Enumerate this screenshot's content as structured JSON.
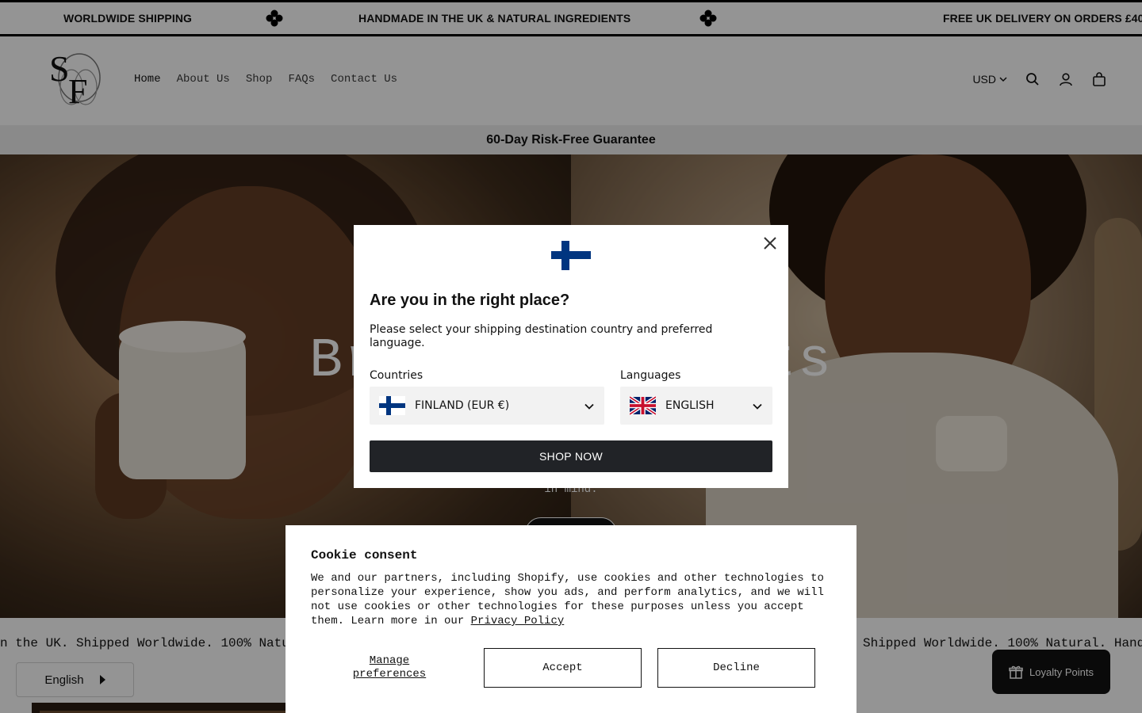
{
  "announcement": {
    "items": [
      "WORLDWIDE SHIPPING",
      "HANDMADE IN THE UK & NATURAL INGREDIENTS",
      "FREE UK DELIVERY ON ORDERS £40"
    ],
    "separator_icon": "four-petal-flower-icon"
  },
  "header": {
    "logo_text": "SF",
    "nav": [
      "Home",
      "About Us",
      "Shop",
      "FAQs",
      "Contact Us"
    ],
    "currency": "USD",
    "icons": [
      "search-icon",
      "account-icon",
      "cart-icon"
    ]
  },
  "guarantee": {
    "text": "60-Day Risk-Free Guarantee"
  },
  "hero": {
    "title": "Browse Products",
    "subtitle": "in mind."
  },
  "band": {
    "segments": [
      "n the UK. Shipped Worldwide.  100% Natu",
      "Shipped Worldwide.  100% Natural. Hand"
    ]
  },
  "language_switch": {
    "label": "English"
  },
  "loyalty": {
    "label": "Loyalty Points",
    "icon": "gift-icon"
  },
  "geo_modal": {
    "title": "Are you in the right place?",
    "description": "Please select your shipping destination country and preferred language.",
    "countries_label": "Countries",
    "country_value": "FINLAND (EUR €)",
    "languages_label": "Languages",
    "language_value": "ENGLISH",
    "shop_button": "SHOP NOW",
    "colors": {
      "finland_blue": "#003580",
      "button_bg": "#212327"
    }
  },
  "cookie": {
    "title": "Cookie consent",
    "body": "We and our partners, including Shopify, use cookies and other technologies to personalize your experience, show you ads, and perform analytics, and we will not use cookies or other technologies for these purposes unless you accept them. Learn more in our ",
    "privacy_link": "Privacy Policy",
    "manage": "Manage preferences",
    "accept": "Accept",
    "decline": "Decline"
  }
}
